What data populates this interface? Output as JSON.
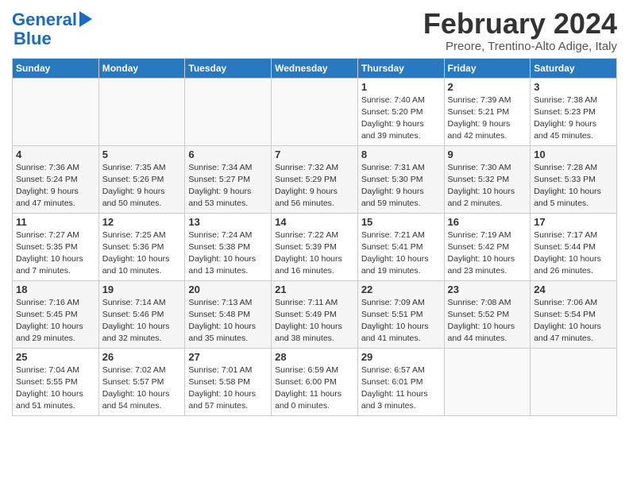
{
  "header": {
    "logo_line1": "General",
    "logo_line2": "Blue",
    "month_year": "February 2024",
    "subtitle": "Preore, Trentino-Alto Adige, Italy"
  },
  "columns": [
    "Sunday",
    "Monday",
    "Tuesday",
    "Wednesday",
    "Thursday",
    "Friday",
    "Saturday"
  ],
  "weeks": [
    [
      {
        "day": "",
        "info": ""
      },
      {
        "day": "",
        "info": ""
      },
      {
        "day": "",
        "info": ""
      },
      {
        "day": "",
        "info": ""
      },
      {
        "day": "1",
        "info": "Sunrise: 7:40 AM\nSunset: 5:20 PM\nDaylight: 9 hours\nand 39 minutes."
      },
      {
        "day": "2",
        "info": "Sunrise: 7:39 AM\nSunset: 5:21 PM\nDaylight: 9 hours\nand 42 minutes."
      },
      {
        "day": "3",
        "info": "Sunrise: 7:38 AM\nSunset: 5:23 PM\nDaylight: 9 hours\nand 45 minutes."
      }
    ],
    [
      {
        "day": "4",
        "info": "Sunrise: 7:36 AM\nSunset: 5:24 PM\nDaylight: 9 hours\nand 47 minutes."
      },
      {
        "day": "5",
        "info": "Sunrise: 7:35 AM\nSunset: 5:26 PM\nDaylight: 9 hours\nand 50 minutes."
      },
      {
        "day": "6",
        "info": "Sunrise: 7:34 AM\nSunset: 5:27 PM\nDaylight: 9 hours\nand 53 minutes."
      },
      {
        "day": "7",
        "info": "Sunrise: 7:32 AM\nSunset: 5:29 PM\nDaylight: 9 hours\nand 56 minutes."
      },
      {
        "day": "8",
        "info": "Sunrise: 7:31 AM\nSunset: 5:30 PM\nDaylight: 9 hours\nand 59 minutes."
      },
      {
        "day": "9",
        "info": "Sunrise: 7:30 AM\nSunset: 5:32 PM\nDaylight: 10 hours\nand 2 minutes."
      },
      {
        "day": "10",
        "info": "Sunrise: 7:28 AM\nSunset: 5:33 PM\nDaylight: 10 hours\nand 5 minutes."
      }
    ],
    [
      {
        "day": "11",
        "info": "Sunrise: 7:27 AM\nSunset: 5:35 PM\nDaylight: 10 hours\nand 7 minutes."
      },
      {
        "day": "12",
        "info": "Sunrise: 7:25 AM\nSunset: 5:36 PM\nDaylight: 10 hours\nand 10 minutes."
      },
      {
        "day": "13",
        "info": "Sunrise: 7:24 AM\nSunset: 5:38 PM\nDaylight: 10 hours\nand 13 minutes."
      },
      {
        "day": "14",
        "info": "Sunrise: 7:22 AM\nSunset: 5:39 PM\nDaylight: 10 hours\nand 16 minutes."
      },
      {
        "day": "15",
        "info": "Sunrise: 7:21 AM\nSunset: 5:41 PM\nDaylight: 10 hours\nand 19 minutes."
      },
      {
        "day": "16",
        "info": "Sunrise: 7:19 AM\nSunset: 5:42 PM\nDaylight: 10 hours\nand 23 minutes."
      },
      {
        "day": "17",
        "info": "Sunrise: 7:17 AM\nSunset: 5:44 PM\nDaylight: 10 hours\nand 26 minutes."
      }
    ],
    [
      {
        "day": "18",
        "info": "Sunrise: 7:16 AM\nSunset: 5:45 PM\nDaylight: 10 hours\nand 29 minutes."
      },
      {
        "day": "19",
        "info": "Sunrise: 7:14 AM\nSunset: 5:46 PM\nDaylight: 10 hours\nand 32 minutes."
      },
      {
        "day": "20",
        "info": "Sunrise: 7:13 AM\nSunset: 5:48 PM\nDaylight: 10 hours\nand 35 minutes."
      },
      {
        "day": "21",
        "info": "Sunrise: 7:11 AM\nSunset: 5:49 PM\nDaylight: 10 hours\nand 38 minutes."
      },
      {
        "day": "22",
        "info": "Sunrise: 7:09 AM\nSunset: 5:51 PM\nDaylight: 10 hours\nand 41 minutes."
      },
      {
        "day": "23",
        "info": "Sunrise: 7:08 AM\nSunset: 5:52 PM\nDaylight: 10 hours\nand 44 minutes."
      },
      {
        "day": "24",
        "info": "Sunrise: 7:06 AM\nSunset: 5:54 PM\nDaylight: 10 hours\nand 47 minutes."
      }
    ],
    [
      {
        "day": "25",
        "info": "Sunrise: 7:04 AM\nSunset: 5:55 PM\nDaylight: 10 hours\nand 51 minutes."
      },
      {
        "day": "26",
        "info": "Sunrise: 7:02 AM\nSunset: 5:57 PM\nDaylight: 10 hours\nand 54 minutes."
      },
      {
        "day": "27",
        "info": "Sunrise: 7:01 AM\nSunset: 5:58 PM\nDaylight: 10 hours\nand 57 minutes."
      },
      {
        "day": "28",
        "info": "Sunrise: 6:59 AM\nSunset: 6:00 PM\nDaylight: 11 hours\nand 0 minutes."
      },
      {
        "day": "29",
        "info": "Sunrise: 6:57 AM\nSunset: 6:01 PM\nDaylight: 11 hours\nand 3 minutes."
      },
      {
        "day": "",
        "info": ""
      },
      {
        "day": "",
        "info": ""
      }
    ]
  ]
}
